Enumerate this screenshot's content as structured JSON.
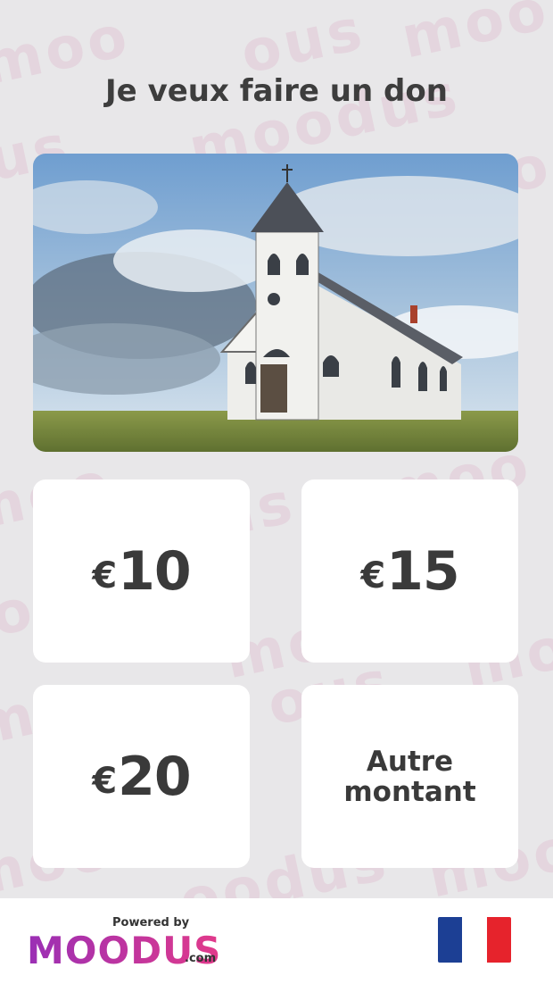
{
  "header": {
    "title": "Je veux faire un don"
  },
  "hero": {
    "image_name": "church-photo"
  },
  "amounts": [
    {
      "currency": "€",
      "value": "10"
    },
    {
      "currency": "€",
      "value": "15"
    },
    {
      "currency": "€",
      "value": "20"
    }
  ],
  "other_amount": {
    "line1": "Autre",
    "line2": "montant"
  },
  "footer": {
    "powered_by": "Powered by",
    "brand": "MOODUS",
    "domain": ".com"
  },
  "language": {
    "name": "flag-fr-icon",
    "colors": [
      "#1c3f94",
      "#ffffff",
      "#e6232c"
    ]
  },
  "colors": {
    "background": "#e8e7e9",
    "text": "#3d3d3d",
    "brand_start": "#9a2fb5",
    "brand_end": "#e23a8a"
  }
}
